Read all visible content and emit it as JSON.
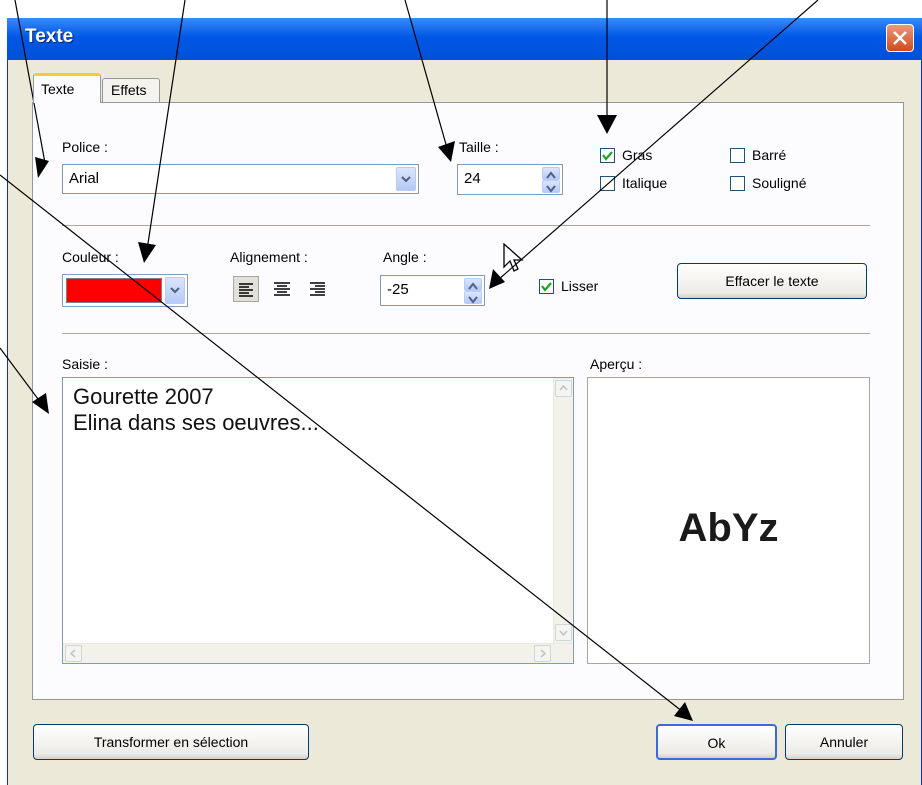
{
  "window": {
    "title": "Texte"
  },
  "tabs": [
    {
      "label": "Texte"
    },
    {
      "label": "Effets"
    }
  ],
  "police": {
    "label": "Police :",
    "value": "Arial"
  },
  "taille": {
    "label": "Taille :",
    "value": "24"
  },
  "style": {
    "gras": {
      "label": "Gras",
      "checked": true
    },
    "italique": {
      "label": "Italique",
      "checked": false
    },
    "barre": {
      "label": "Barré",
      "checked": false
    },
    "souligne": {
      "label": "Souligné",
      "checked": false
    }
  },
  "couleur": {
    "label": "Couleur :",
    "color": "#ff0000"
  },
  "alignement": {
    "label": "Alignement :",
    "options": [
      "left",
      "center",
      "right"
    ],
    "selected": "left"
  },
  "angle": {
    "label": "Angle :",
    "value": "-25"
  },
  "lisser": {
    "label": "Lisser",
    "checked": true
  },
  "effacer_button": "Effacer le texte",
  "saisie": {
    "label": "Saisie :",
    "text": "Gourette 2007\nElina dans ses oeuvres..."
  },
  "apercu": {
    "label": "Aperçu :",
    "sample": "AbYz"
  },
  "footer": {
    "transform_button": "Transformer en sélection",
    "ok_button": "Ok",
    "cancel_button": "Annuler"
  }
}
